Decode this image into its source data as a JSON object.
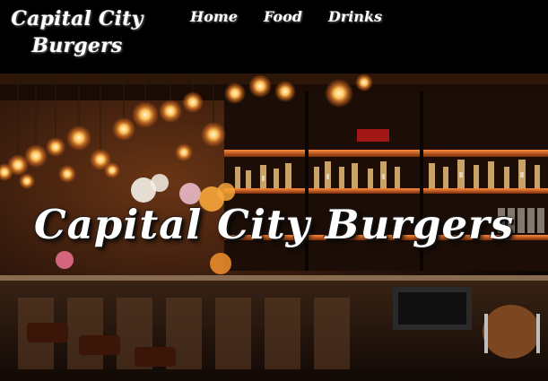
{
  "site": {
    "logo_line1": "Capital City",
    "logo_line2": "Burgers"
  },
  "nav": {
    "items": [
      "Home",
      "Food",
      "Drinks"
    ]
  },
  "hero": {
    "title": "Capital City Burgers",
    "image_description_icon": "bar-interior-photo"
  },
  "colors": {
    "header_bg": "#000000",
    "text": "#ffffff",
    "text_shadow": "#6d6d6d",
    "bulb_glow": "#ffb347"
  }
}
